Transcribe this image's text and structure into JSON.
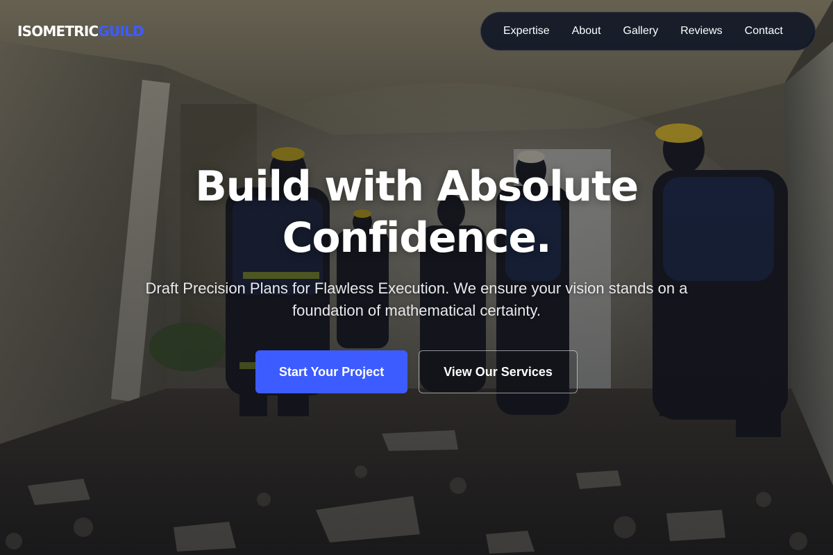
{
  "header": {
    "logo_part1": "ISOMETRIC",
    "logo_part2": "GUILD"
  },
  "nav": {
    "items": [
      "Expertise",
      "About",
      "Gallery",
      "Reviews",
      "Contact"
    ]
  },
  "hero": {
    "headline_line1": "Build with Absolute",
    "headline_line2": "Confidence.",
    "subtitle": "Draft Precision Plans for Flawless Execution. We ensure your vision stands on a foundation of mathematical certainty.",
    "primary_button": "Start Your Project",
    "secondary_button": "View Our Services"
  },
  "colors": {
    "accent": "#3d5cff",
    "nav_background": "#0f1426",
    "text": "#ffffff"
  }
}
